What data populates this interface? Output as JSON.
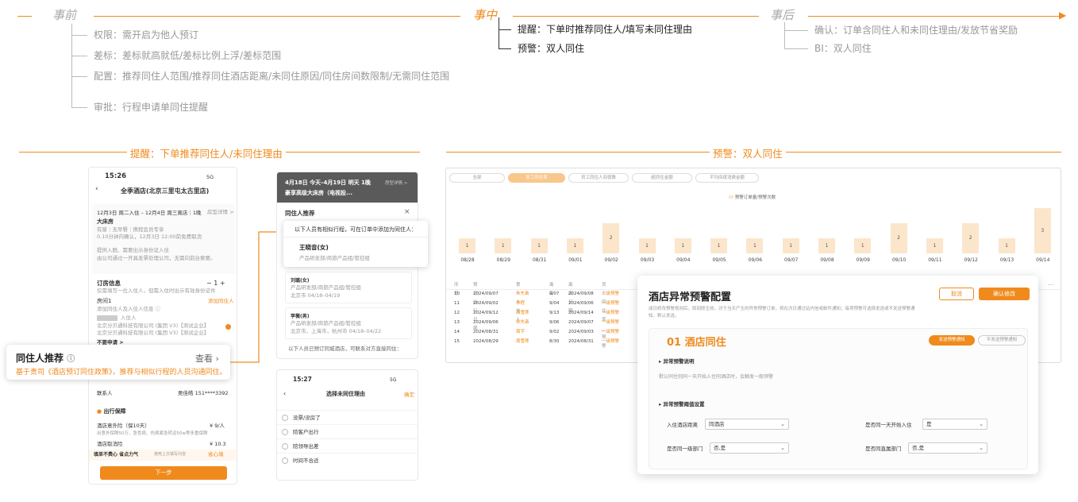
{
  "timeline": {
    "before": {
      "label": "事前",
      "items": [
        "权限：需开启为他人预订",
        "差标：差标就高就低/差标比例上浮/差标范围",
        "配置：推荐同住人范围/推荐同住酒店距离/未同住原因/同住房间数限制/无需同住范围",
        "审批：行程申请单同住提醒"
      ]
    },
    "during": {
      "label": "事中",
      "items": [
        "提醒：下单时推荐同住人/填写未同住理由",
        "预警：双人同住"
      ]
    },
    "after": {
      "label": "事后",
      "items": [
        "确认：订单含同住人和未同住理由/发放节省奖励",
        "BI：双人同住"
      ]
    }
  },
  "section_left": "提醒：下单推荐同住人/未同住理由",
  "section_right": "预警：双人同住",
  "phone1": {
    "time": "15:26",
    "signal": "5G",
    "hotel": "全季酒店(北京三里屯太古里店)",
    "dates": "12月3日 周二入住 – 12月4日 周三离店｜1晚",
    "detail_link": "房型详情 >",
    "room": "大床房",
    "room_sub1": "有窗｜无早餐｜携程会员专享",
    "room_sub2": "0.10分钟内确认，12月3日 12:00前免费取消",
    "room_sub3": "提供入脱、需要出示身份证入住",
    "room_sub4": "由公司通过一开具发票处理公司，无需向前台索要。",
    "order_info": "订房信息",
    "order_sub": "仅需填写一位入住人，但需入住时出示有效身份证件",
    "qty": "1",
    "room1": "房间1",
    "room1_sub": "添加同住人及入住人信息 ⓘ",
    "add_roommate": "添加同住人",
    "guest_role": "入住人",
    "company1": "北京分贝通科技有限公司 (集团 V3)【测试企业】",
    "company2": "北京分贝通科技有限公司 (集团 V3)【测试企业】",
    "more": "不要申请 >",
    "contact": "联系人",
    "contact_val": "吴佳皓 151****3392",
    "guarantee": "出行保障",
    "insurance": "酒店意外险（保10天）",
    "insurance_price": "¥ 9/人",
    "insurance_sub": "出意外保障50万，急性病、伤病紧急转运50w等多重保障",
    "insurance2": "酒店取消险",
    "insurance2_price": "¥ 10.3",
    "bottom_promo": "填单不费心 省点力气",
    "bottom_promo_sub": "使用上次填写内容",
    "bottom_link": "省心填",
    "next": "下一步"
  },
  "popup": {
    "title": "同住人推荐",
    "view": "查看",
    "desc": "基于贵司《酒店预订同住政策》，推荐与相似行程的人员沟通同住。"
  },
  "phone2": {
    "header_line1": "4月18日 今天–4月19日 明天  1晚",
    "header_link": "房型详情 >",
    "header_line2": "豪享高级大床房（电视投...",
    "panel_title": "同住人推荐",
    "close": "×",
    "hint": "以下人员有相似行程，可在订单中添加为同住人：",
    "person1": "王晓音(女)",
    "person1_dept": "产品研发部/商旅产品组/管控组",
    "person2": "刘璐(女)",
    "person2_dept": "产品研发部/商旅产品组/管控组",
    "person2_route": "北京市 04/18–04/19",
    "person3": "李薇(男)",
    "person3_dept": "产品研发部/商旅产品组/管控组",
    "person3_route": "北京市，上海市，杭州市 04/18–04/22",
    "footer": "以下人员已预订同城酒店，可联系对方直接同住："
  },
  "phone3": {
    "time": "15:27",
    "signal": "5G",
    "title": "选择未同住理由",
    "confirm": "确定",
    "reasons": [
      "没票/没房了",
      "陪客户出行",
      "陪领导出差",
      "时间不合适"
    ]
  },
  "dashboard": {
    "tabs": [
      "全部",
      "员工同住率",
      "员工同住人间夜数",
      "超同住金额",
      "平均间夜消费金额"
    ],
    "legend": "预警订单量/预警次数",
    "table_headers": [
      "序号",
      "预订/出行日期",
      "第一入住人",
      "离店",
      "离店日期",
      "员工同住率_预警"
    ],
    "rows": [
      [
        "10",
        "2024/09/07",
        "朱先奋",
        "9/07",
        "2024/09/08",
        "一级预警"
      ],
      [
        "11",
        "2024/09/02",
        "李程",
        "9/04",
        "2024/09/06",
        "一级预警"
      ],
      [
        "12",
        "2024/09/12",
        "周雪莲",
        "9/13",
        "2024/09/14",
        "一级预警"
      ],
      [
        "13",
        "2024/09/06",
        "朱先奋",
        "9/06",
        "2024/09/07",
        "一级预警"
      ],
      [
        "14",
        "2024/08/31",
        "周宇",
        "9/02",
        "2024/09/03",
        "一级预警"
      ],
      [
        "15",
        "2024/08/29",
        "周雪莲",
        "8/30",
        "2024/08/31",
        "一级预警"
      ]
    ],
    "more": "..."
  },
  "chart_data": {
    "type": "bar",
    "categories": [
      "08/28",
      "08/29",
      "08/31",
      "09/01",
      "09/02",
      "09/03",
      "09/04",
      "09/05",
      "09/06",
      "09/07",
      "09/08",
      "09/09",
      "09/10",
      "09/11",
      "09/12",
      "09/13",
      "09/14"
    ],
    "values": [
      1,
      1,
      1,
      1,
      2,
      1,
      1,
      1,
      1,
      1,
      1,
      1,
      2,
      1,
      2,
      1,
      3
    ],
    "ylim": [
      0,
      3.5
    ],
    "legend": "预警订单量/预警次数"
  },
  "modal": {
    "title": "酒店异常预警配置",
    "desc": "成功修改预警规则后，即刻即生效，对于当天产生的异常预警订单，将在次日通过站内信或邮件通知；每项预警可选择发送或不发送预警通知，默认发送。",
    "cancel": "取消",
    "confirm": "确认修改",
    "rule_title": "01 酒店同住",
    "send": "发送预警通知",
    "nosend": "不发送预警通知",
    "sec1": "▸ 异常预警说明",
    "sec1_desc": "默认同住则同一天开始入住同酒店时，会触发一般预警",
    "sec2": "▸ 异常预警阈值设置",
    "f1_label": "入住酒店距离",
    "f1_val": "同酒店",
    "f2_label": "是否同一天开始入住",
    "f2_val": "是",
    "f3_label": "是否同一级部门",
    "f3_val": "否,是",
    "f4_label": "是否同直属部门",
    "f4_val": "否,是"
  }
}
